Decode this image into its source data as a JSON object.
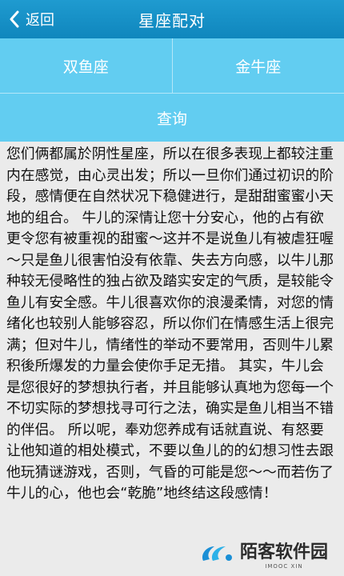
{
  "header": {
    "back_label": "返回",
    "title": "星座配对"
  },
  "selectors": {
    "sign_one": "双鱼座",
    "sign_two": "金牛座"
  },
  "query_label": "查询",
  "result_text": "您们俩都属於阴性星座，所以在很多表现上都较注重内在感觉，由心灵出发；所以一旦你们通过初识的阶段，感情便在自然状况下稳健进行，是甜甜蜜蜜小天地的组合。 牛儿的深情让您十分安心，他的占有欲更令您有被重视的甜蜜～这并不是说鱼儿有被虐狂喔～只是鱼儿很害怕没有依靠、失去方向感，以牛儿那种较无侵略性的独占欲及踏实安定的气质，是较能令鱼儿有安全感。牛儿很喜欢你的浪漫柔情，对您的情绪化也较别人能够容忍，所以你们在情感生活上很完满；但对牛儿，情绪性的举动不要常用，否则牛儿累积後所爆发的力量会使你手足无措。 其实，牛儿会是您很好的梦想执行者，并且能够认真地为您每一个不切实际的梦想找寻可行之法，确实是鱼儿相当不错的伴侣。 所以呢，奉劝您养成有话就直说、有怒要让他知道的相处模式，不要以鱼儿的的幻想习性去跟他玩猜谜游戏，否则，气昏的可能是您～～而若伤了牛儿的心，他也会“乾脆”地终结这段感情！",
  "watermark": {
    "name": "陌客软件园",
    "sub": "IMOOC XIN"
  },
  "colors": {
    "title_bar": "#1592c8",
    "button_bg": "#62cdf1",
    "page_bg": "#ebebeb"
  },
  "icons": {
    "back": "chevron-left-icon",
    "watermark_logo": "logo-icon"
  }
}
